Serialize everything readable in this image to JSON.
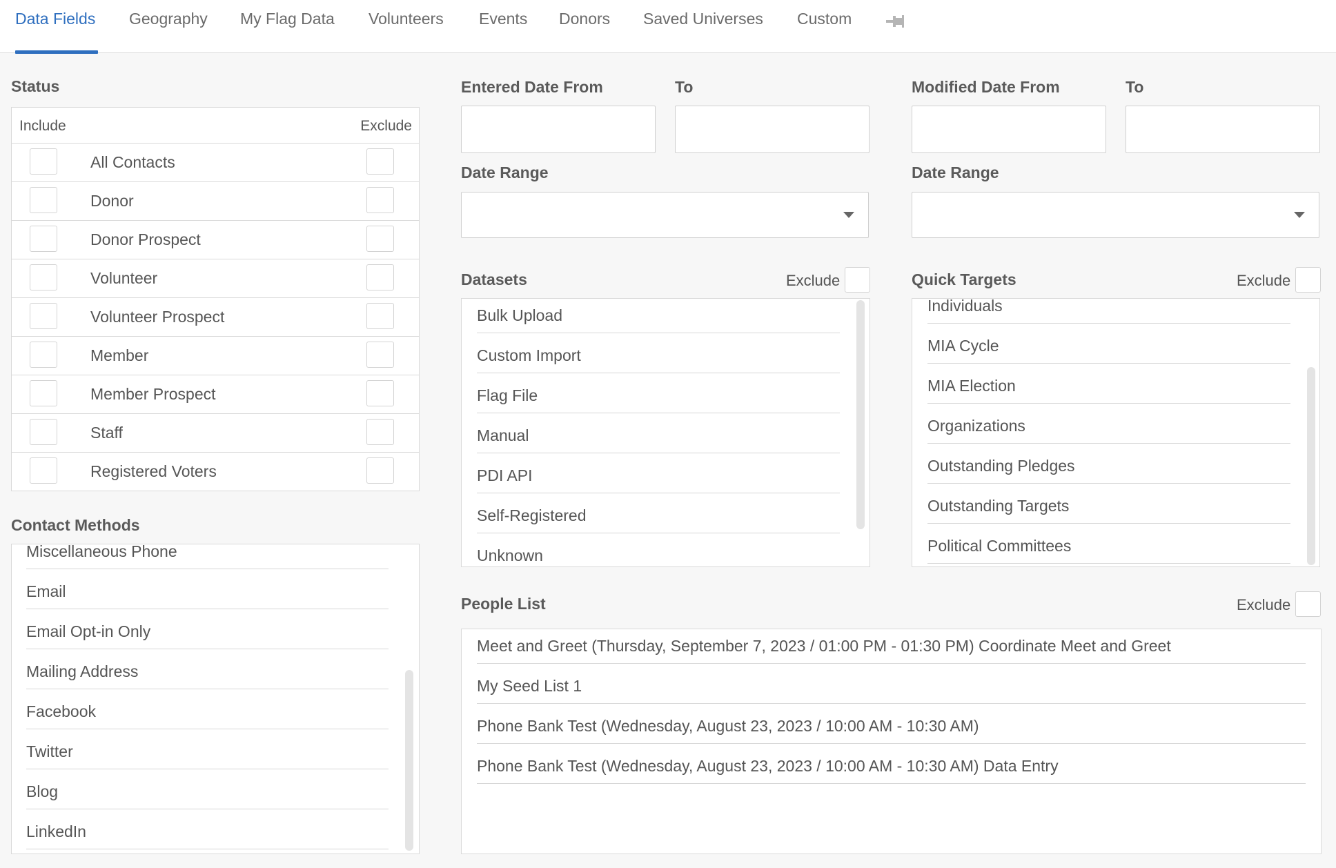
{
  "tabs": [
    "Data Fields",
    "Geography",
    "My Flag Data",
    "Volunteers",
    "Events",
    "Donors",
    "Saved Universes",
    "Custom"
  ],
  "pin_icon": "pin-icon",
  "status": {
    "heading": "Status",
    "include_label": "Include",
    "exclude_label": "Exclude",
    "rows": [
      "All Contacts",
      "Donor",
      "Donor Prospect",
      "Volunteer",
      "Volunteer Prospect",
      "Member",
      "Member Prospect",
      "Staff",
      "Registered Voters"
    ]
  },
  "contact_methods": {
    "heading": "Contact Methods",
    "items": [
      "Miscellaneous Phone",
      "Email",
      "Email Opt-in Only",
      "Mailing Address",
      "Facebook",
      "Twitter",
      "Blog",
      "LinkedIn"
    ]
  },
  "entered_date": {
    "from_label": "Entered Date From",
    "to_label": "To",
    "from_value": "",
    "to_value": "",
    "range_label": "Date Range",
    "range_value": ""
  },
  "modified_date": {
    "from_label": "Modified Date From",
    "to_label": "To",
    "from_value": "",
    "to_value": "",
    "range_label": "Date Range",
    "range_value": ""
  },
  "datasets": {
    "heading": "Datasets",
    "exclude_label": "Exclude",
    "items": [
      "Bulk Upload",
      "Custom Import",
      "Flag File",
      "Manual",
      "PDI API",
      "Self-Registered",
      "Unknown"
    ]
  },
  "quick_targets": {
    "heading": "Quick Targets",
    "exclude_label": "Exclude",
    "items": [
      "Individuals",
      "MIA Cycle",
      "MIA Election",
      "Organizations",
      "Outstanding Pledges",
      "Outstanding Targets",
      "Political Committees"
    ]
  },
  "people_list": {
    "heading": "People List",
    "exclude_label": "Exclude",
    "items": [
      "Meet and Greet (Thursday, September 7, 2023 / 01:00 PM - 01:30 PM) Coordinate Meet and Greet",
      "My Seed List 1",
      "Phone Bank Test (Wednesday, August 23, 2023 / 10:00 AM - 10:30 AM)",
      "Phone Bank Test (Wednesday, August 23, 2023 / 10:00 AM - 10:30 AM) Data Entry"
    ]
  },
  "colors": {
    "accent": "#2f6fbf",
    "background": "#f7f7f7"
  }
}
